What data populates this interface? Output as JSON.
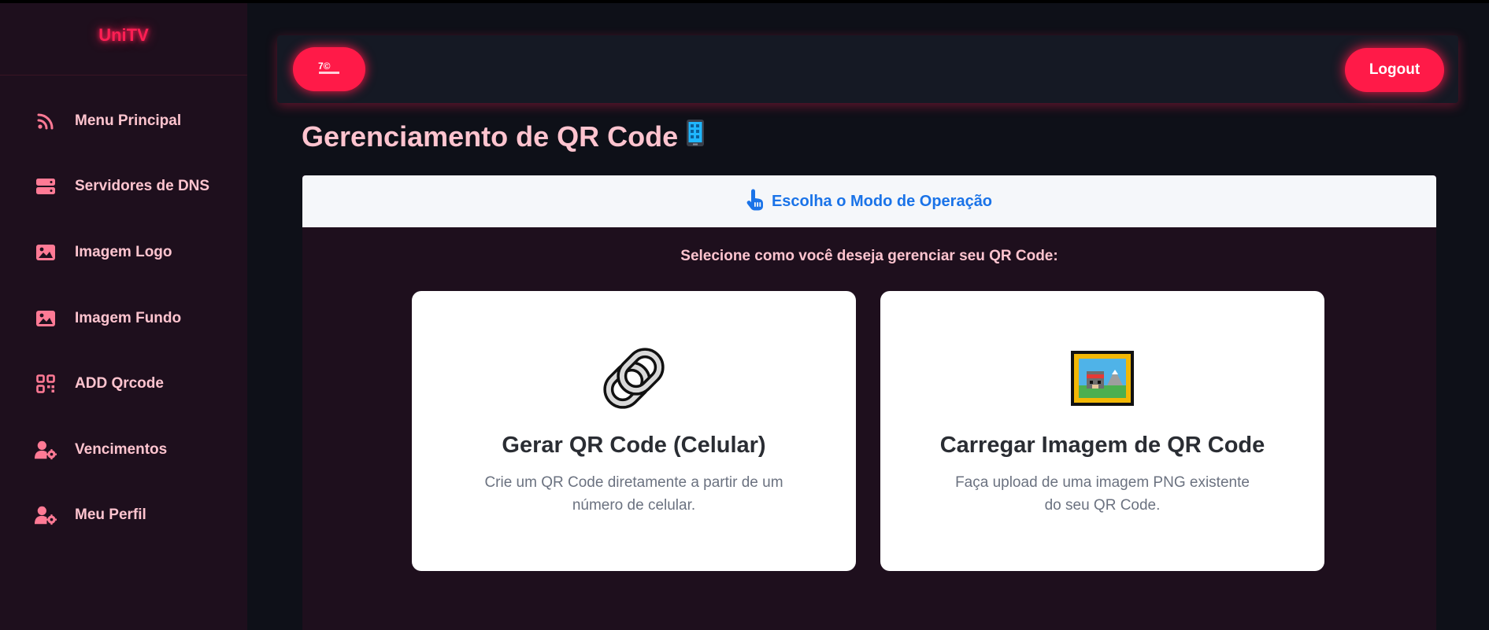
{
  "app": {
    "brand": "UniTV",
    "logo_badge": "7©"
  },
  "sidebar": {
    "items": [
      {
        "label": "Menu Principal",
        "icon": "rss-icon"
      },
      {
        "label": "Servidores de DNS",
        "icon": "server-icon"
      },
      {
        "label": "Imagem Logo",
        "icon": "image-icon"
      },
      {
        "label": "Imagem Fundo",
        "icon": "image-icon"
      },
      {
        "label": "ADD Qrcode",
        "icon": "qrcode-icon"
      },
      {
        "label": "Vencimentos",
        "icon": "user-gear-icon"
      },
      {
        "label": "Meu Perfil",
        "icon": "user-gear-icon"
      }
    ]
  },
  "header": {
    "logout_label": "Logout"
  },
  "page": {
    "title": "Gerenciamento de QR Code"
  },
  "mode_card": {
    "header_label": "Escolha o Modo de Operação",
    "instruction": "Selecione como você deseja gerenciar seu QR Code:",
    "options": [
      {
        "title": "Gerar QR Code (Celular)",
        "description": "Crie um QR Code diretamente a partir de um número de celular.",
        "icon": "link-icon"
      },
      {
        "title": "Carregar Imagem de QR Code",
        "description": "Faça upload de uma imagem PNG existente do seu QR Code.",
        "icon": "framed-picture-icon"
      }
    ]
  },
  "colors": {
    "accent": "#ff1a48",
    "sidebar_bg": "#1e0f1d",
    "page_bg": "#0e1018",
    "header_bg": "#151924",
    "nav_text": "#ffc4cf",
    "link_blue": "#1a73e8"
  }
}
